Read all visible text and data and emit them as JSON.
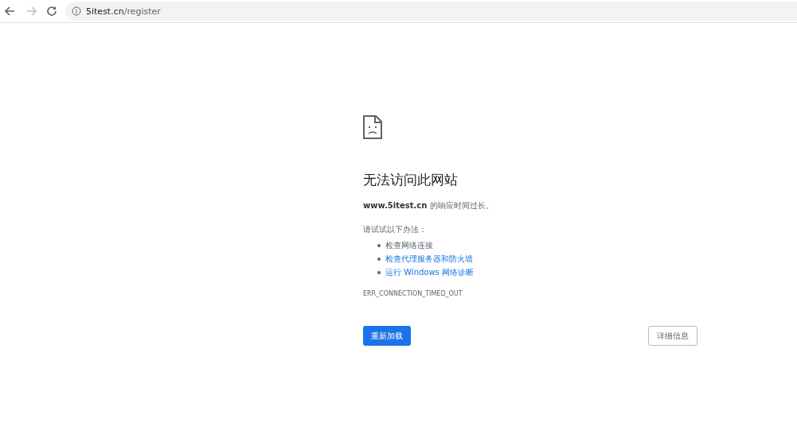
{
  "toolbar": {
    "url_host": "5itest.cn",
    "url_path": "/register"
  },
  "error": {
    "title": "无法访问此网站",
    "message": "**www.5itest.cn** 的响应时间过长。",
    "suggestion_heading": "请试试以下办法：",
    "suggestions": [
      {
        "kind": "text",
        "text": "检查网络连接"
      },
      {
        "kind": "link",
        "text": "检查代理服务器和防火墙"
      },
      {
        "kind": "link",
        "text": "运行 Windows 网络诊断"
      }
    ],
    "code": "ERR_CONNECTION_TIMED_OUT",
    "reload_button": "重新加载",
    "details_button": "详细信息"
  }
}
